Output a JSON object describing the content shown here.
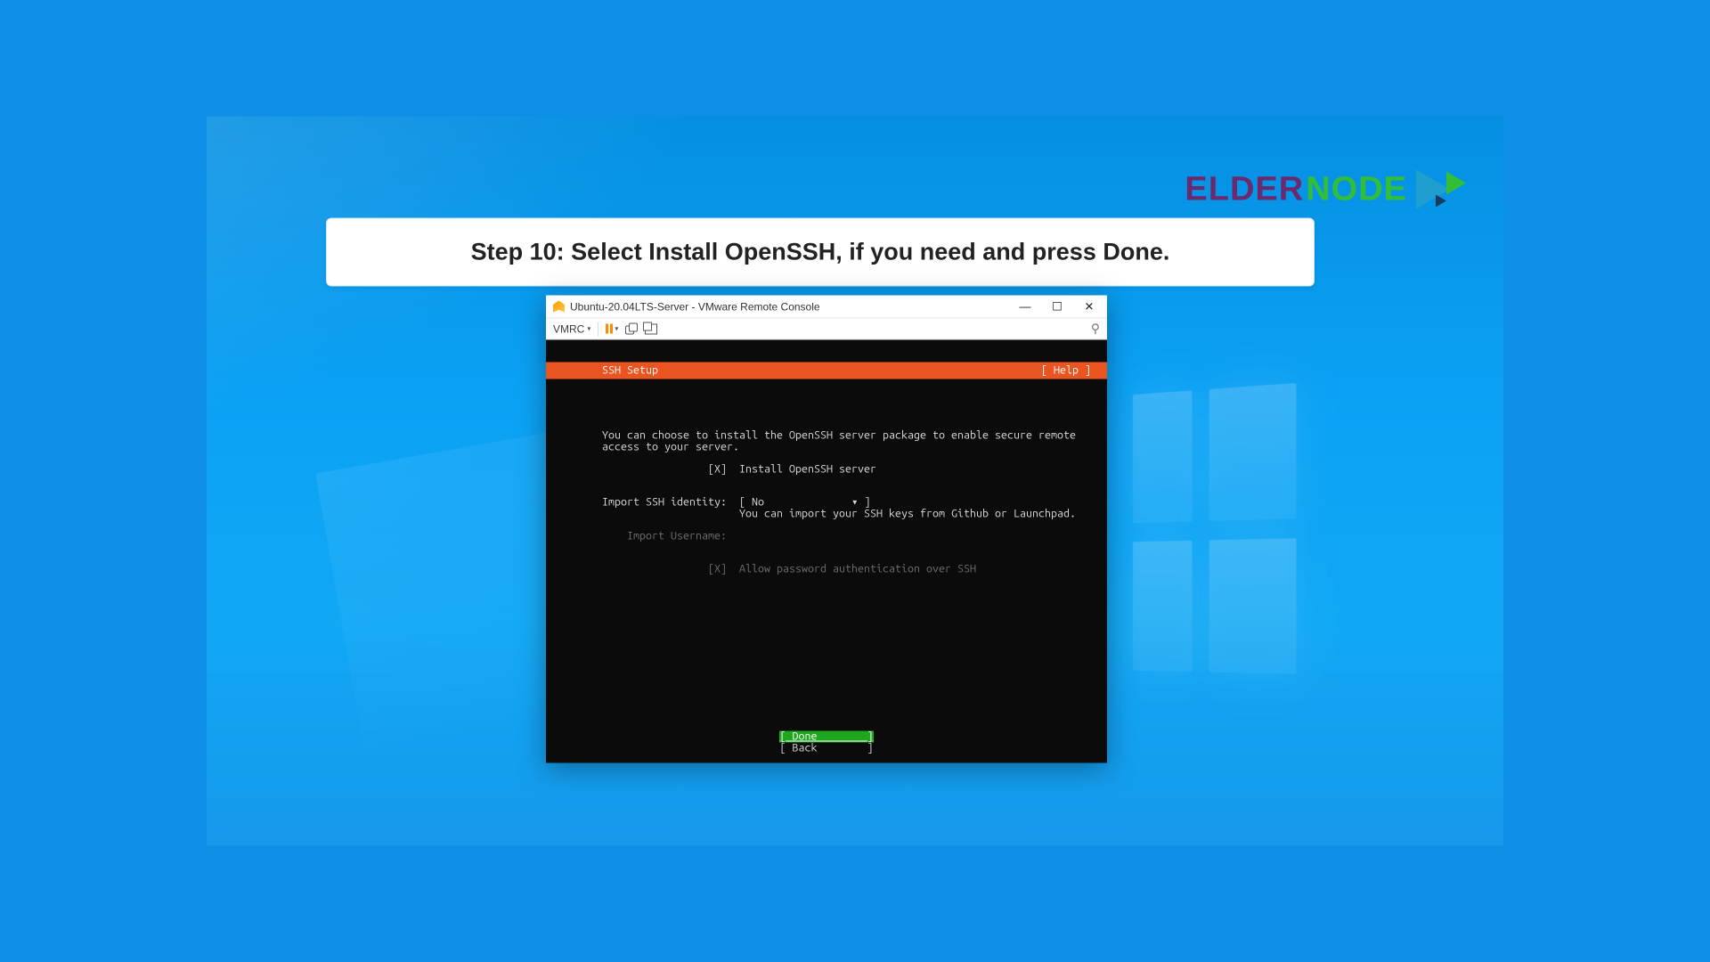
{
  "brand": {
    "part1": "ELDER",
    "part2": "NODE"
  },
  "banner": {
    "text": "Step 10: Select Install OpenSSH, if you need and press Done."
  },
  "window": {
    "title": "Ubuntu-20.04LTS-Server - VMware Remote Console",
    "controls": {
      "minimize": "—",
      "maximize": "☐",
      "close": "✕"
    }
  },
  "toolbar": {
    "menu_label": "VMRC",
    "pin": "⚲"
  },
  "installer": {
    "header_title": "SSH Setup",
    "header_help": "[ Help ]",
    "intro_line1": "You can choose to install the OpenSSH server package to enable secure remote",
    "intro_line2": "access to your server.",
    "install_checkbox": "[X]",
    "install_label": "Install OpenSSH server",
    "import_label": "Import SSH identity:",
    "import_value": "[ No              ▾ ]",
    "import_hint": "You can import your SSH keys from Github or Launchpad.",
    "username_label": "Import Username:",
    "allow_checkbox": "[X]",
    "allow_label": "Allow password authentication over SSH",
    "done_btn": "[ Done        ]",
    "back_btn": "[ Back        ]"
  }
}
